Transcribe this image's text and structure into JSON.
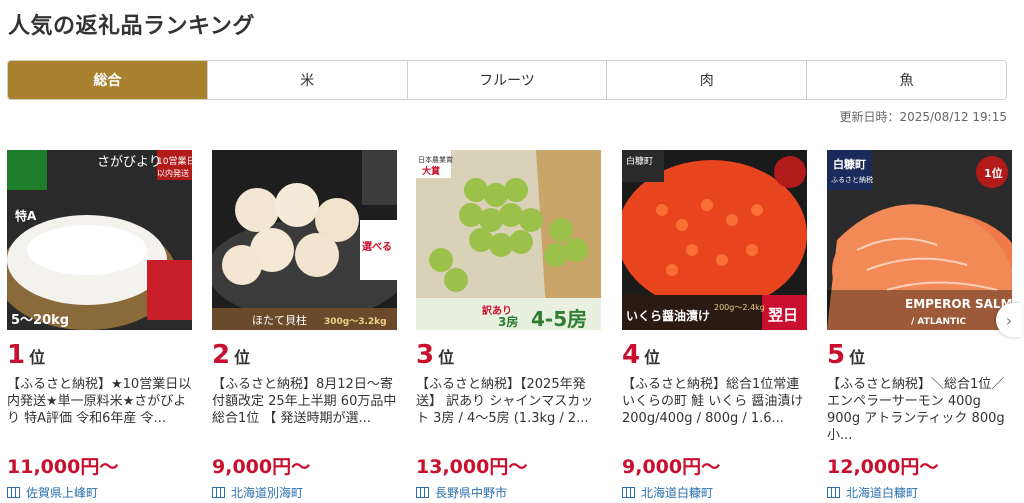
{
  "title": "人気の返礼品ランキング",
  "tabs": [
    "総合",
    "米",
    "フルーツ",
    "肉",
    "魚"
  ],
  "updated": "更新日時：2025/08/12 19:15",
  "rank_suffix": "位",
  "items": [
    {
      "rank": "1",
      "desc": "【ふるさと納税】★10営業日以内発送★単一原料米★さがびより 特A評価 令和6年産 令...",
      "price": "11,000円～",
      "location": "佐賀県上峰町",
      "thumb_texts": [
        "さがびより",
        "10営業日",
        "以内発送",
        "特A",
        "5～20kg"
      ]
    },
    {
      "rank": "2",
      "desc": "【ふるさと納税】8月12日～寄付額改定 25年上半期 60万品中 総合1位 【 発送時期が選...",
      "price": "9,000円～",
      "location": "北海道別海町",
      "thumb_texts": [
        "選べる",
        "ほたて貝柱",
        "300g～3.2kg"
      ]
    },
    {
      "rank": "3",
      "desc": "【ふるさと納税】【2025年発送】 訳あり シャインマスカット 3房 / 4～5房 (1.3kg / 2...",
      "price": "13,000円～",
      "location": "長野県中野市",
      "thumb_texts": [
        "日本農業賞",
        "大賞",
        "訳あり",
        "3房",
        "4-5房"
      ]
    },
    {
      "rank": "4",
      "desc": "【ふるさと納税】総合1位常連 いくらの町 鮭 いくら 醤油漬け 200g/400g / 800g / 1.6...",
      "price": "9,000円～",
      "location": "北海道白糠町",
      "thumb_texts": [
        "白糠町",
        "いくら醤油漬け",
        "200g～2.4kg",
        "翌日"
      ]
    },
    {
      "rank": "5",
      "desc": "【ふるさと納税】＼総合1位／エンペラーサーモン 400g 900g アトランティック 800g 小...",
      "price": "12,000円～",
      "location": "北海道白糠町",
      "thumb_texts": [
        "白糠町",
        "ふるさと納税",
        "EMPEROR SALMON",
        "/ ATLANTIC",
        "1位"
      ]
    }
  ],
  "colors": {
    "accent": "#a8822f",
    "price": "#c8102e",
    "link": "#2a6fb0"
  },
  "icons": {
    "next": "chevron-right-icon",
    "location": "map-icon"
  }
}
